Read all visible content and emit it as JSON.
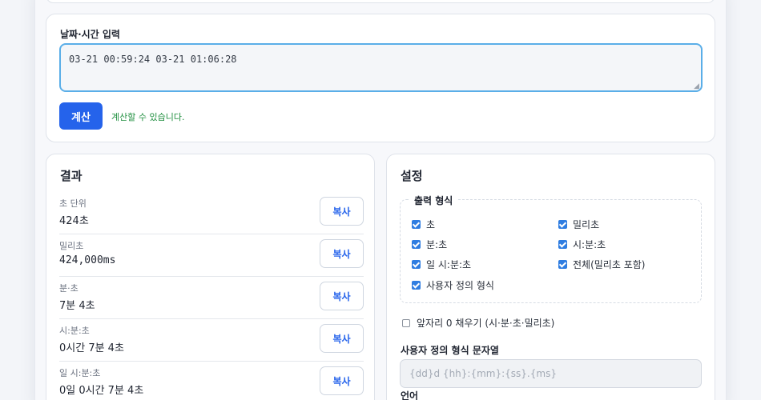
{
  "input_section": {
    "label": "날짜·시간 입력",
    "value": "03-21 00:59:24 03-21 01:06:28",
    "calc_button": "계산",
    "status": "계산할 수 있습니다."
  },
  "results": {
    "title": "결과",
    "copy_label": "복사",
    "rows": [
      {
        "label": "초 단위",
        "value": "424초"
      },
      {
        "label": "밀리초",
        "value": "424,000ms"
      },
      {
        "label": "분·초",
        "value": "7분 4초"
      },
      {
        "label": "시:분:초",
        "value": "0시간 7분 4초"
      },
      {
        "label": "일 시:분:초",
        "value": "0일 0시간 7분 4초"
      }
    ]
  },
  "settings": {
    "title": "설정",
    "format_legend": "출력 형식",
    "format_options": [
      {
        "label": "초",
        "checked": true
      },
      {
        "label": "밀리초",
        "checked": true
      },
      {
        "label": "분:초",
        "checked": true
      },
      {
        "label": "시:분:초",
        "checked": true
      },
      {
        "label": "일 시:분:초",
        "checked": true
      },
      {
        "label": "전체(밀리초 포함)",
        "checked": true
      },
      {
        "label": "사용자 정의 형식",
        "checked": true
      }
    ],
    "pad_zero_label": "앞자리 0 채우기 (시·분·초·밀리초)",
    "pad_zero_checked": false,
    "custom_format_label": "사용자 정의 형식 문자열",
    "custom_format_placeholder": "{dd}d {hh}:{mm}:{ss}.{ms}",
    "language_label": "언어"
  },
  "colors": {
    "accent": "#2563eb",
    "status_ok": "#1e8e3e",
    "focus_border": "#5aaee8"
  }
}
